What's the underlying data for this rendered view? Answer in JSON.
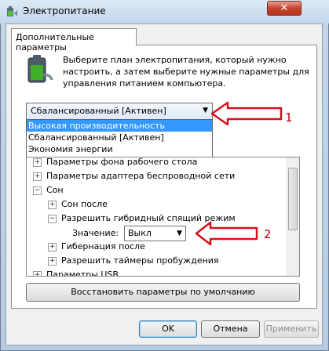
{
  "window": {
    "title": "Электропитание",
    "close_glyph": "✕"
  },
  "tab": {
    "label": "Дополнительные параметры"
  },
  "description": "Выберите план электропитания, который нужно настроить, а затем выберите нужные параметры для управления питанием компьютера.",
  "plan_select": {
    "value": "Сбалансированный [Активен]",
    "options": [
      "Высокая производительность",
      "Сбалансированный [Активен]",
      "Экономия энергии"
    ]
  },
  "tree": {
    "items": [
      {
        "label": "Параметры фона рабочего стола",
        "toggle": "+"
      },
      {
        "label": "Параметры адаптера беспроводной сети",
        "toggle": "+"
      },
      {
        "label": "Сон",
        "toggle": "−"
      },
      {
        "label": "Сон после",
        "toggle": "+"
      },
      {
        "label": "Разрешить гибридный спящий режим",
        "toggle": "−"
      },
      {
        "label": "Гибернация после",
        "toggle": "+"
      },
      {
        "label": "Разрешить таймеры пробуждения",
        "toggle": "+"
      },
      {
        "label": "Параметры USB",
        "toggle": "+"
      }
    ],
    "value_label": "Значение:",
    "value_select": "Выкл"
  },
  "buttons": {
    "restore": "Восстановить параметры по умолчанию",
    "ok": "OK",
    "cancel": "Отмена",
    "apply": "Применить"
  },
  "annotations": {
    "one": "1",
    "two": "2"
  },
  "colors": {
    "selection": "#3399ff",
    "annotation_red": "#c0000d",
    "battery_green": "#3fae2a"
  },
  "icons": {
    "app": "power-options-icon",
    "battery": "battery-icon"
  }
}
